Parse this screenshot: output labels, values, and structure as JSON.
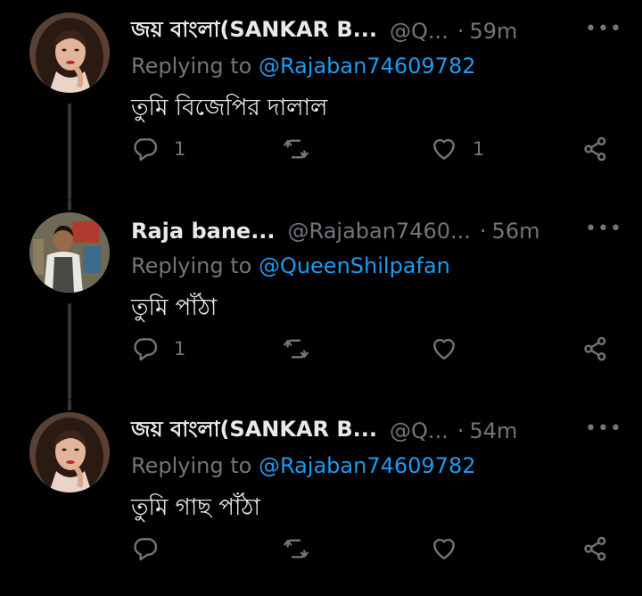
{
  "tweets": [
    {
      "name": "জয় বাংলা(SANKAR B...",
      "handle": "@Q...",
      "dot": "·",
      "time": "59m",
      "replying_prefix": "Replying to ",
      "replying_to": "@Rajaban74609782",
      "text": "তুমি বিজেপির দালাল",
      "reply_count": "1",
      "retweet_count": "",
      "like_count": "1"
    },
    {
      "name": "Raja bane...",
      "handle": "@Rajaban7460...",
      "dot": "·",
      "time": "56m",
      "replying_prefix": "Replying to ",
      "replying_to": "@QueenShilpafan",
      "text": "তুমি পাঁঠা",
      "reply_count": "1",
      "retweet_count": "",
      "like_count": ""
    },
    {
      "name": "জয় বাংলা(SANKAR B...",
      "handle": "@Q...",
      "dot": "·",
      "time": "54m",
      "replying_prefix": "Replying to ",
      "replying_to": "@Rajaban74609782",
      "text": "তুমি গাছ পাঁঠা",
      "reply_count": "",
      "retweet_count": "",
      "like_count": ""
    }
  ],
  "more_label": "•••",
  "icons": {
    "reply": "reply-icon",
    "retweet": "retweet-icon",
    "like": "heart-icon",
    "share": "share-icon",
    "more": "more-icon"
  },
  "colors": {
    "background": "#000000",
    "text": "#e7e9ea",
    "muted": "#71767b",
    "link": "#1d9bf0",
    "thread_line": "#333639"
  }
}
